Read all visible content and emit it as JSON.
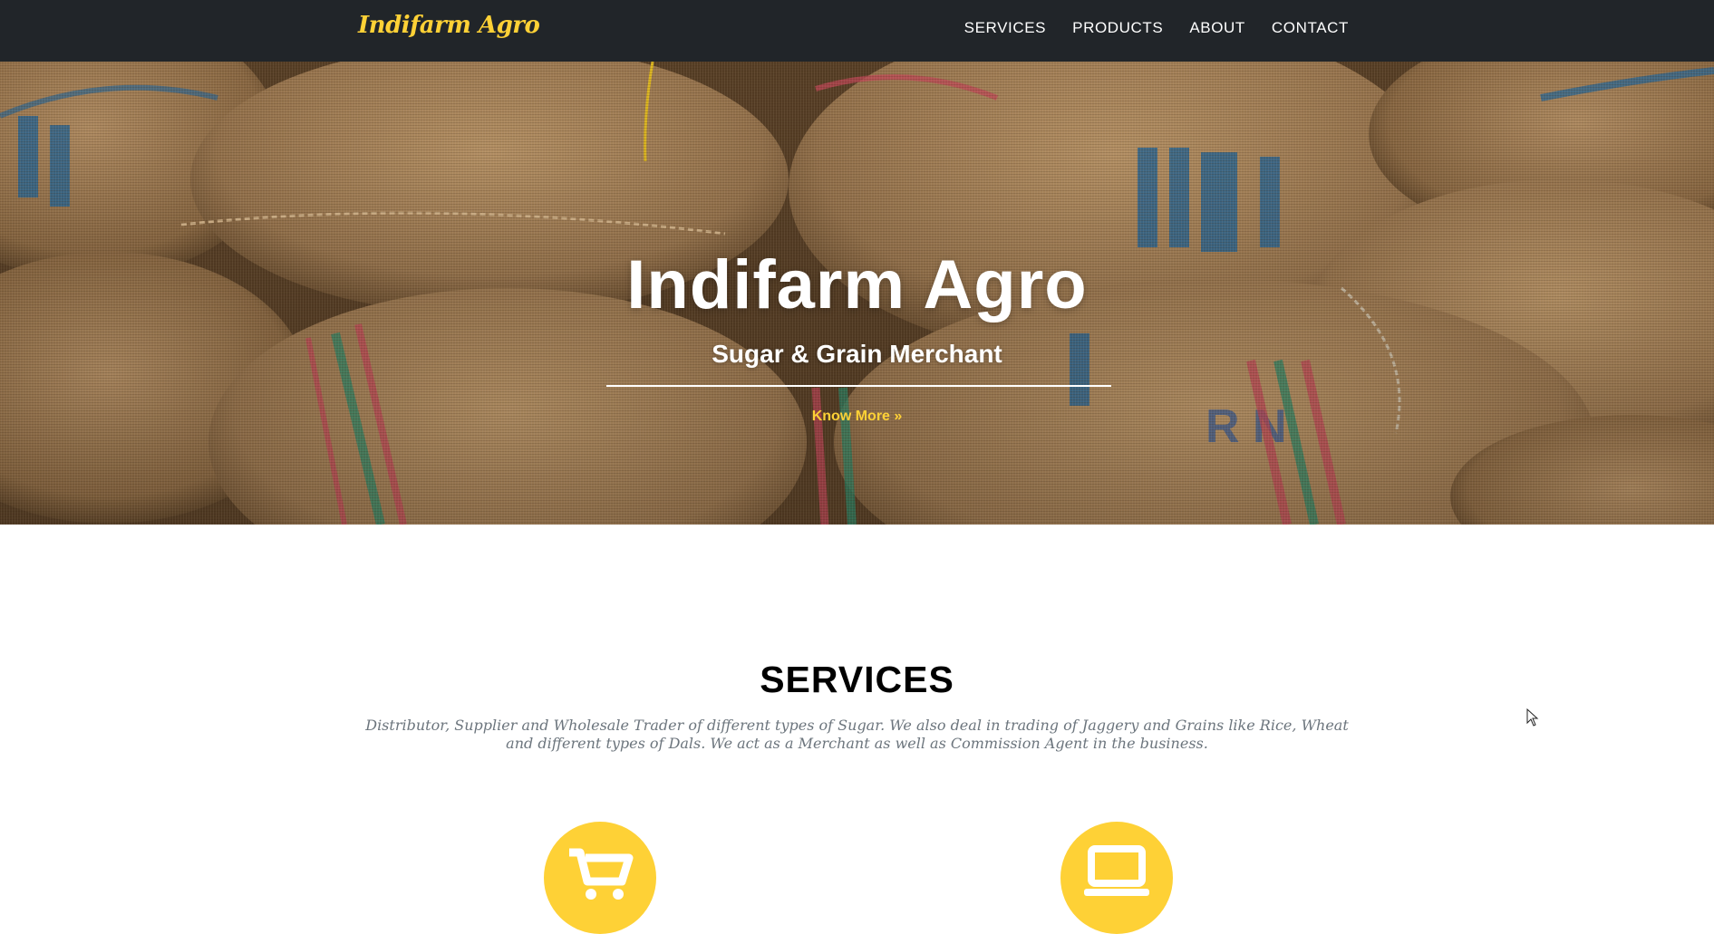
{
  "navbar": {
    "brand": "Indifarm Agro",
    "links": [
      "SERVICES",
      "PRODUCTS",
      "ABOUT",
      "CONTACT"
    ]
  },
  "hero": {
    "title": "Indifarm Agro",
    "subtitle": "Sugar & Grain Merchant",
    "cta": "Know More »"
  },
  "services": {
    "heading": "SERVICES",
    "description": "Distributor, Supplier and Wholesale Trader of different types of Sugar. We also deal in trading of Jaggery and Grains like Rice, Wheat and different types of Dals. We act as a Merchant as well as Commission Agent in the business.",
    "icons": [
      "shopping-cart-icon",
      "laptop-icon"
    ]
  },
  "colors": {
    "accent": "#fed136",
    "navbar_bg": "#212529",
    "muted_text": "#6c757d"
  }
}
